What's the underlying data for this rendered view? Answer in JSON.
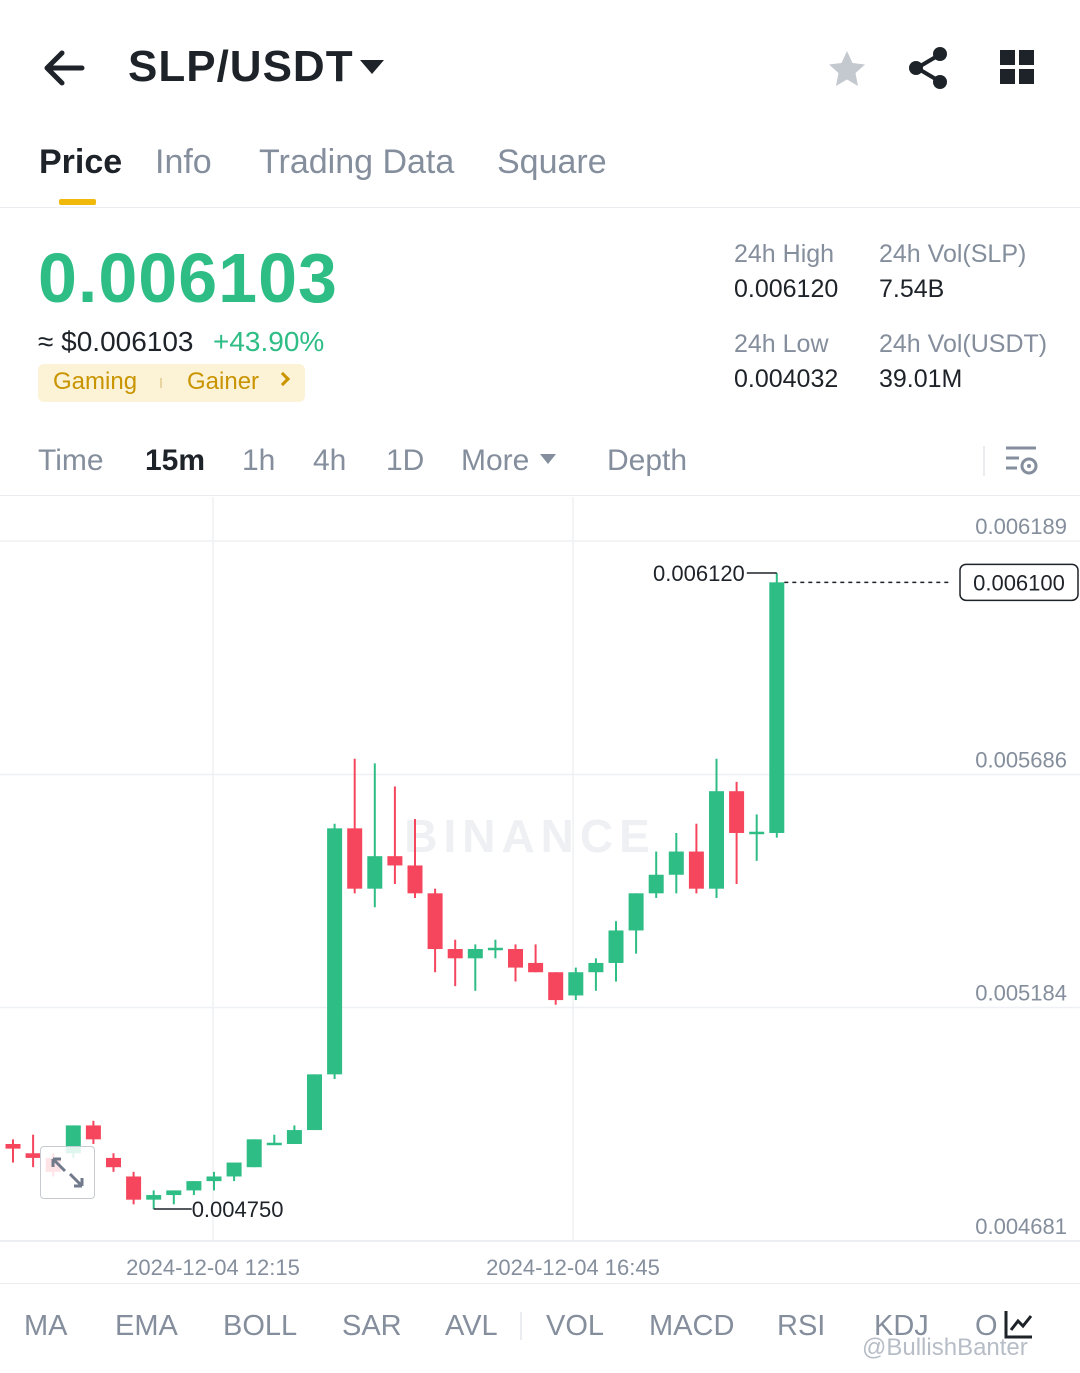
{
  "header": {
    "pair": "SLP/USDT"
  },
  "tabs": [
    "Price",
    "Info",
    "Trading Data",
    "Square"
  ],
  "ticker": {
    "last_price": "0.006103",
    "approx_usd": "≈ $0.006103",
    "change_pct": "+43.90%",
    "tags": [
      "Gaming",
      "Gainer"
    ],
    "high_label": "24h High",
    "high_value": "0.006120",
    "vol_slp_label": "24h Vol(SLP)",
    "vol_slp_value": "7.54B",
    "low_label": "24h Low",
    "low_value": "0.004032",
    "vol_usdt_label": "24h Vol(USDT)",
    "vol_usdt_value": "39.01M"
  },
  "intervals": [
    "Time",
    "15m",
    "1h",
    "4h",
    "1D",
    "More",
    "Depth"
  ],
  "active_interval": "15m",
  "chart_data": {
    "type": "candlestick",
    "y_ticks": [
      "0.006189",
      "0.005686",
      "0.005184",
      "0.004681"
    ],
    "ylim": [
      0.00461,
      0.00628
    ],
    "x_ticks": [
      "2024-12-04 12:15",
      "2024-12-04 16:45"
    ],
    "high_marker": "0.006120",
    "low_marker": "0.004750",
    "current_price_label": "0.006100",
    "watermark": "BINANCE",
    "candles": [
      {
        "o": 0.00489,
        "h": 0.0049,
        "l": 0.00485,
        "c": 0.00488
      },
      {
        "o": 0.00487,
        "h": 0.00491,
        "l": 0.00484,
        "c": 0.00486
      },
      {
        "o": 0.00486,
        "h": 0.00487,
        "l": 0.00482,
        "c": 0.00483
      },
      {
        "o": 0.00487,
        "h": 0.00493,
        "l": 0.00486,
        "c": 0.00493
      },
      {
        "o": 0.00493,
        "h": 0.00494,
        "l": 0.00489,
        "c": 0.0049
      },
      {
        "o": 0.00486,
        "h": 0.00487,
        "l": 0.00483,
        "c": 0.00484
      },
      {
        "o": 0.00482,
        "h": 0.00483,
        "l": 0.00476,
        "c": 0.00477
      },
      {
        "o": 0.00477,
        "h": 0.00479,
        "l": 0.00475,
        "c": 0.00478
      },
      {
        "o": 0.00478,
        "h": 0.00479,
        "l": 0.00476,
        "c": 0.00479
      },
      {
        "o": 0.00479,
        "h": 0.00481,
        "l": 0.00478,
        "c": 0.00481
      },
      {
        "o": 0.00481,
        "h": 0.00483,
        "l": 0.00479,
        "c": 0.00482
      },
      {
        "o": 0.00482,
        "h": 0.00485,
        "l": 0.00481,
        "c": 0.00485
      },
      {
        "o": 0.00484,
        "h": 0.0049,
        "l": 0.00484,
        "c": 0.0049
      },
      {
        "o": 0.00489,
        "h": 0.00491,
        "l": 0.00489,
        "c": 0.00489
      },
      {
        "o": 0.00489,
        "h": 0.00493,
        "l": 0.00489,
        "c": 0.00492
      },
      {
        "o": 0.00492,
        "h": 0.00504,
        "l": 0.00492,
        "c": 0.00504
      },
      {
        "o": 0.00504,
        "h": 0.00558,
        "l": 0.00503,
        "c": 0.00557
      },
      {
        "o": 0.00557,
        "h": 0.00572,
        "l": 0.00543,
        "c": 0.00544
      },
      {
        "o": 0.00544,
        "h": 0.00571,
        "l": 0.0054,
        "c": 0.00551
      },
      {
        "o": 0.00551,
        "h": 0.00566,
        "l": 0.00545,
        "c": 0.00549
      },
      {
        "o": 0.00549,
        "h": 0.00559,
        "l": 0.00542,
        "c": 0.00543
      },
      {
        "o": 0.00543,
        "h": 0.00544,
        "l": 0.00526,
        "c": 0.00531
      },
      {
        "o": 0.00531,
        "h": 0.00533,
        "l": 0.00523,
        "c": 0.00529
      },
      {
        "o": 0.00529,
        "h": 0.00532,
        "l": 0.00522,
        "c": 0.00531
      },
      {
        "o": 0.00531,
        "h": 0.00533,
        "l": 0.00529,
        "c": 0.00531
      },
      {
        "o": 0.00531,
        "h": 0.00532,
        "l": 0.00524,
        "c": 0.00527
      },
      {
        "o": 0.00528,
        "h": 0.00532,
        "l": 0.00526,
        "c": 0.00526
      },
      {
        "o": 0.00526,
        "h": 0.00526,
        "l": 0.00519,
        "c": 0.0052
      },
      {
        "o": 0.00521,
        "h": 0.00527,
        "l": 0.0052,
        "c": 0.00526
      },
      {
        "o": 0.00526,
        "h": 0.00529,
        "l": 0.00522,
        "c": 0.00528
      },
      {
        "o": 0.00528,
        "h": 0.00537,
        "l": 0.00524,
        "c": 0.00535
      },
      {
        "o": 0.00535,
        "h": 0.00543,
        "l": 0.0053,
        "c": 0.00543
      },
      {
        "o": 0.00543,
        "h": 0.00552,
        "l": 0.00542,
        "c": 0.00547
      },
      {
        "o": 0.00547,
        "h": 0.00556,
        "l": 0.00543,
        "c": 0.00552
      },
      {
        "o": 0.00552,
        "h": 0.00558,
        "l": 0.00543,
        "c": 0.00544
      },
      {
        "o": 0.00544,
        "h": 0.00572,
        "l": 0.00542,
        "c": 0.00565
      },
      {
        "o": 0.00565,
        "h": 0.00567,
        "l": 0.00545,
        "c": 0.00556
      },
      {
        "o": 0.00556,
        "h": 0.0056,
        "l": 0.0055,
        "c": 0.00556
      },
      {
        "o": 0.00556,
        "h": 0.00612,
        "l": 0.00555,
        "c": 0.0061
      }
    ]
  },
  "indicators": [
    "MA",
    "EMA",
    "BOLL",
    "SAR",
    "AVL",
    "VOL",
    "MACD",
    "RSI",
    "KDJ",
    "O"
  ],
  "watermark_handle": "@BullishBanter",
  "colors": {
    "up": "#2ebd85",
    "down": "#f6465d",
    "accent": "#f0b90b",
    "muted": "#848e9c",
    "text": "#1e2329"
  }
}
